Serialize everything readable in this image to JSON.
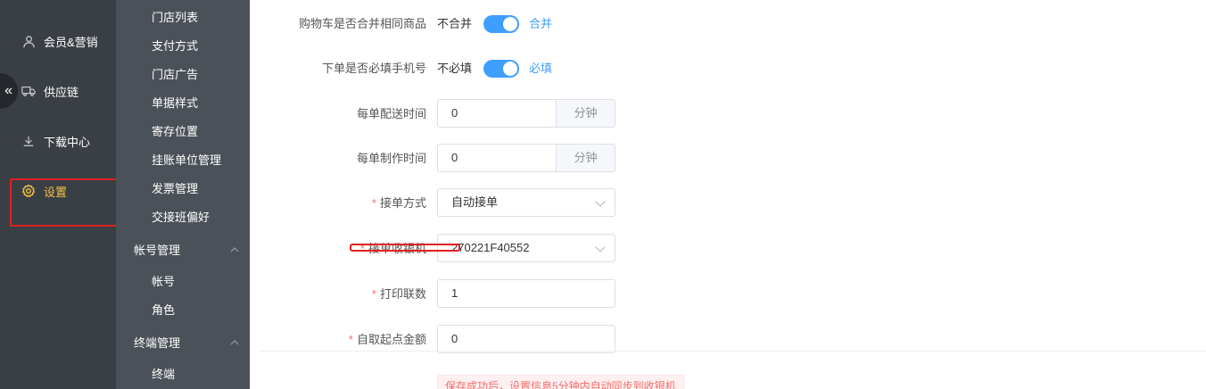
{
  "sidebar": {
    "items": [
      {
        "label": "会员&营销",
        "icon": "user-icon"
      },
      {
        "label": "供应链",
        "icon": "truck-icon"
      },
      {
        "label": "下载中心",
        "icon": "download-icon"
      },
      {
        "label": "设置",
        "icon": "gear-icon",
        "active": true
      }
    ],
    "collapse_icon": "«",
    "active_color": "#f5c242"
  },
  "submenu": {
    "items": [
      "门店列表",
      "支付方式",
      "门店广告",
      "单据样式",
      "寄存位置",
      "挂账单位管理",
      "发票管理",
      "交接班偏好"
    ],
    "group_account": {
      "label": "帐号管理",
      "items": [
        "帐号",
        "角色"
      ]
    },
    "group_terminal": {
      "label": "终端管理",
      "items": [
        "终端"
      ]
    }
  },
  "form": {
    "merge_cart": {
      "label": "购物车是否合并相同商品",
      "off_text": "不合并",
      "on_text": "合并",
      "checked": true
    },
    "require_phone": {
      "label": "下单是否必填手机号",
      "off_text": "不必填",
      "on_text": "必填",
      "checked": true
    },
    "delivery_time": {
      "label": "每单配送时间",
      "value": "0",
      "unit": "分钟"
    },
    "make_time": {
      "label": "每单制作时间",
      "value": "0",
      "unit": "分钟"
    },
    "accept_mode": {
      "label": "接单方式",
      "value": "自动接单"
    },
    "accept_printer": {
      "label": "接单收银机",
      "value": "270221F40552"
    },
    "print_copies": {
      "label": "打印联数",
      "value": "1"
    },
    "pickup_min": {
      "label": "自取起点金额",
      "value": "0"
    },
    "required_mark": "*"
  },
  "notice": "保存成功后，设置信息5分钟内自动同步到收银机",
  "colors": {
    "accent": "#409eff",
    "danger": "#f56c6c",
    "sidebar": "#3a3f45",
    "submenu": "#4b5158"
  }
}
